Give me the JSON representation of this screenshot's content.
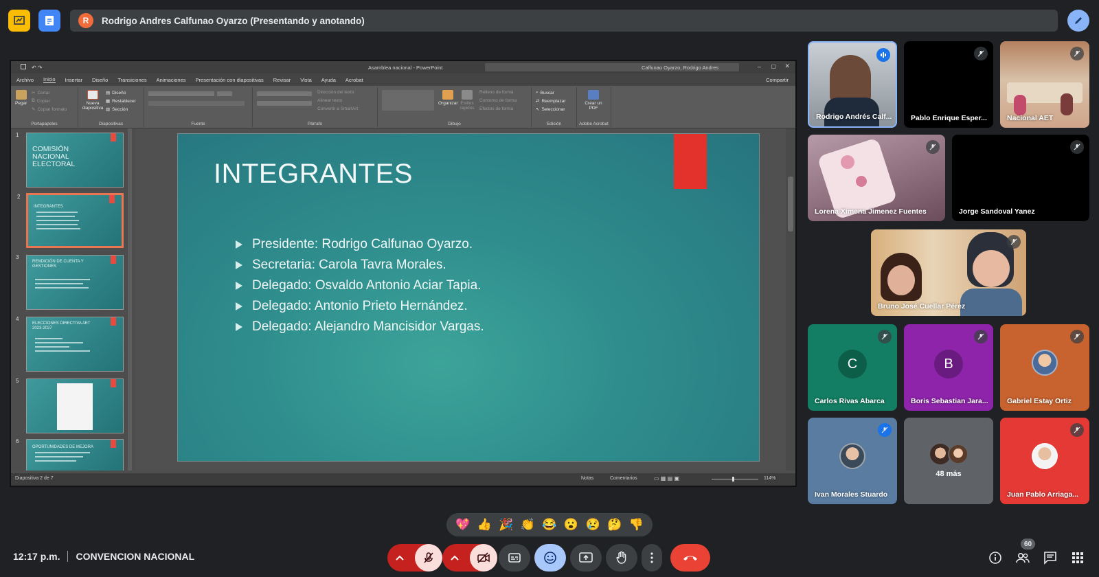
{
  "meet": {
    "presenting_banner": "Rodrigo Andres Calfunao Oyarzo (Presentando y anotando)",
    "presenter_initial": "R",
    "time": "12:17 p.m.",
    "meeting_name": "CONVENCION NACIONAL",
    "people_count": "60"
  },
  "powerpoint": {
    "file_title": "Asamblea nacional - PowerPoint",
    "user": "Calfunao Oyarzo, Rodrigo Andres",
    "share": "Compartir",
    "menu": [
      "Archivo",
      "Inicio",
      "Insertar",
      "Diseño",
      "Transiciones",
      "Animaciones",
      "Presentación con diapositivas",
      "Revisar",
      "Vista",
      "Ayuda",
      "Acrobat"
    ],
    "ribbon_groups": [
      "Portapapeles",
      "Diapositivas",
      "Fuente",
      "Párrafo",
      "Dibujo",
      "Edición",
      "Adobe Acrobat"
    ],
    "ribbon": {
      "paste": "Pegar",
      "cut": "Cortar",
      "copy": "Copiar",
      "format_painter": "Copiar formato",
      "new_slide": "Nueva diapositiva",
      "layout": "Diseño",
      "reset": "Restablecer",
      "section": "Sección",
      "text_direction": "Dirección del texto",
      "align_text": "Alinear texto",
      "convert_smartart": "Convertir a SmartArt",
      "arrange": "Organizar",
      "quick_styles": "Estilos rápidos",
      "shape_fill": "Relleno de forma",
      "shape_outline": "Contorno de forma",
      "shape_effects": "Efectos de forma",
      "find": "Buscar",
      "replace": "Reemplazar",
      "select": "Seleccionar",
      "create_pdf": "Crear un PDF"
    },
    "thumbnails": [
      {
        "num": "1",
        "title": "COMISIÓN NACIONAL ELECTORAL"
      },
      {
        "num": "2",
        "title": "INTEGRANTES"
      },
      {
        "num": "3",
        "title": "RENDICIÓN DE CUENTA Y GESTIONES"
      },
      {
        "num": "4",
        "title": "ELECCIONES DIRECTIVA AET 2023-2027"
      },
      {
        "num": "5",
        "title": ""
      },
      {
        "num": "6",
        "title": "OPORTUNIDADES DE MEJORA"
      }
    ],
    "slide": {
      "title": "INTEGRANTES",
      "bullets": [
        "Presidente: Rodrigo Calfunao Oyarzo.",
        "Secretaria: Carola Tavra Morales.",
        "Delegado: Osvaldo Antonio Aciar Tapia.",
        "Delegado: Antonio Prieto Hernández.",
        "Delegado: Alejandro Mancisidor Vargas."
      ]
    },
    "status": {
      "slide_counter": "Diapositiva 2 de 7",
      "notes": "Notas",
      "comments": "Comentarios",
      "zoom": "114%"
    }
  },
  "participants": [
    {
      "name": "Rodrigo Andrés Calf...",
      "initial": "",
      "speaking": true
    },
    {
      "name": "Pablo Enrique Esper...",
      "initial": ""
    },
    {
      "name": "Nacional AET",
      "initial": ""
    },
    {
      "name": "Lorena Ximena Jimenez Fuentes",
      "initial": ""
    },
    {
      "name": "Jorge Sandoval Yanez",
      "initial": ""
    },
    {
      "name": "Bruno José Cuellar Pérez",
      "initial": ""
    },
    {
      "name": "Carlos Rivas Abarca",
      "initial": "C",
      "color": "#137e63"
    },
    {
      "name": "Boris Sebastian Jara...",
      "initial": "B",
      "color": "#8e24aa"
    },
    {
      "name": "Gabriel Estay Ortiz",
      "initial": ""
    },
    {
      "name": "Ivan Morales Stuardo",
      "initial": ""
    },
    {
      "name": "48 más",
      "initial": ""
    },
    {
      "name": "Juan Pablo Arriaga...",
      "initial": ""
    }
  ],
  "reactions": [
    "💖",
    "👍",
    "🎉",
    "👏",
    "😂",
    "😮",
    "😢",
    "🤔",
    "👎"
  ],
  "colors": {
    "accent": "#8ab4f8",
    "end_call": "#ea4335",
    "muted": "#f28b82",
    "slide_teal": "#2f8e8d",
    "slide_red": "#e3312b"
  }
}
